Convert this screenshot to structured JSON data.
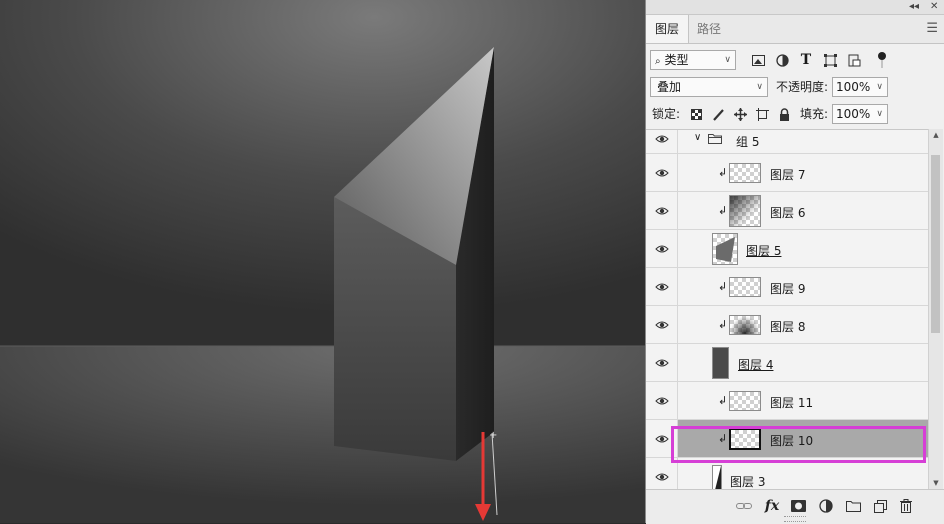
{
  "panel": {
    "tabs": [
      {
        "label": "图层"
      },
      {
        "label": "路径"
      }
    ],
    "filter": {
      "kind": "类型"
    },
    "blend_mode": "叠加",
    "opacity_label": "不透明度:",
    "opacity_value": "100%",
    "lock_label": "锁定:",
    "fill_label": "填充:",
    "fill_value": "100%",
    "layers": [
      {
        "name": "组 5",
        "type": "group",
        "expanded": true,
        "visible": true
      },
      {
        "name": "图层 7",
        "clipped": true,
        "visible": true
      },
      {
        "name": "图层 6",
        "clipped": true,
        "visible": true
      },
      {
        "name": "图层 5",
        "clipped": false,
        "visible": true
      },
      {
        "name": "图层 9",
        "clipped": true,
        "visible": true
      },
      {
        "name": "图层 8",
        "clipped": true,
        "visible": true
      },
      {
        "name": "图层 4",
        "clipped": false,
        "visible": true
      },
      {
        "name": "图层 11",
        "clipped": true,
        "visible": true
      },
      {
        "name": "图层 10",
        "clipped": true,
        "visible": true,
        "selected": true
      },
      {
        "name": "图层 3",
        "clipped": false,
        "visible": true
      }
    ]
  },
  "colors": {
    "selection_highlight": "#d63fd6",
    "arrow": "#e53935",
    "selected_row": "#a9a9a9"
  }
}
